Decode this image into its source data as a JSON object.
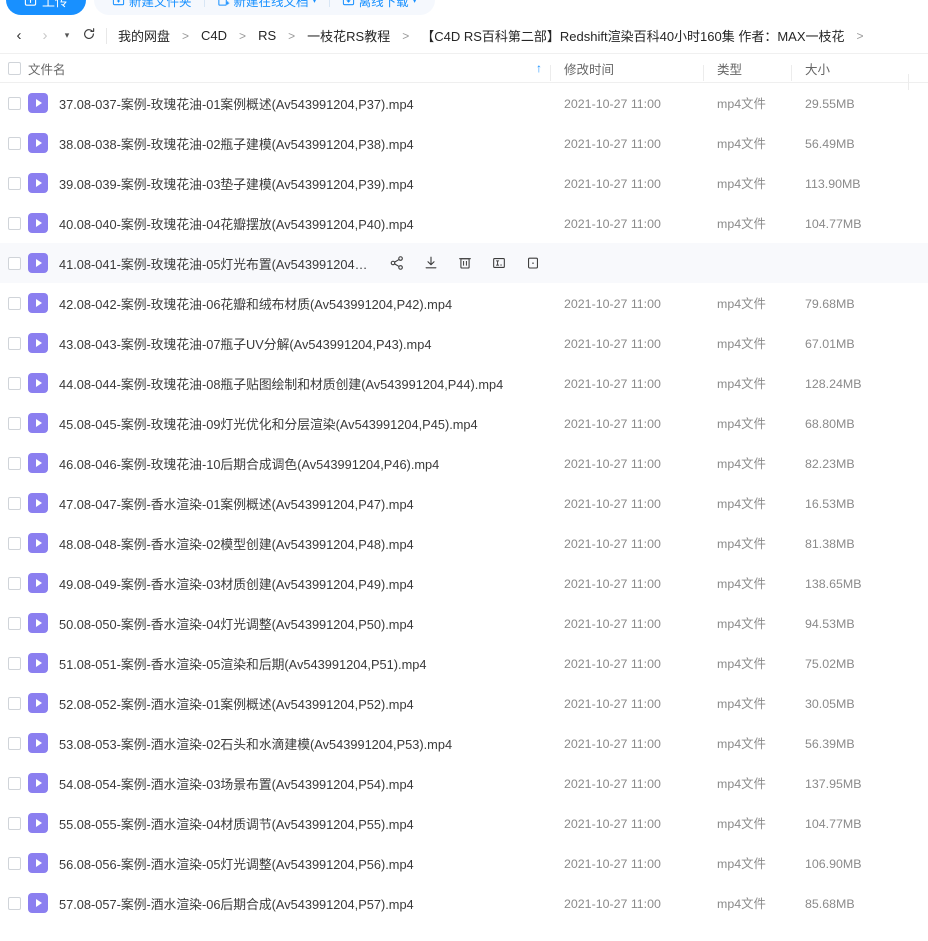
{
  "toolbar": {
    "upload_label": "上传",
    "new_folder_label": "新建文件夹",
    "new_doc_label": "新建在线文档",
    "offline_label": "离线下载"
  },
  "nav": {
    "back_icon": "chevron-left-icon",
    "forward_icon": "chevron-right-icon",
    "history_icon": "caret-down-icon",
    "refresh_icon": "refresh-icon"
  },
  "breadcrumb": {
    "separator": ">",
    "items": [
      "我的网盘",
      "C4D",
      "RS",
      "一枝花RS教程",
      "【C4D RS百科第二部】Redshift渲染百科40小时160集 作者：MAX一枝花"
    ],
    "trailing_separator": ">"
  },
  "table": {
    "columns": {
      "name": "文件名",
      "time": "修改时间",
      "type": "类型",
      "size": "大小"
    },
    "sort_indicator": "↑",
    "select_all_checkbox": "unchecked"
  },
  "hover_actions": [
    {
      "name": "share-icon",
      "label": "分享"
    },
    {
      "name": "download-icon",
      "label": "下载"
    },
    {
      "name": "delete-icon",
      "label": "删除"
    },
    {
      "name": "rename-icon",
      "label": "重命名"
    },
    {
      "name": "more-icon",
      "label": "更多"
    }
  ],
  "rows": [
    {
      "name": "37.08-037-案例-玫瑰花油-01案例概述(Av543991204,P37).mp4",
      "time": "2021-10-27 11:00",
      "type": "mp4文件",
      "size": "29.55MB",
      "hovered": false
    },
    {
      "name": "38.08-038-案例-玫瑰花油-02瓶子建模(Av543991204,P38).mp4",
      "time": "2021-10-27 11:00",
      "type": "mp4文件",
      "size": "56.49MB",
      "hovered": false
    },
    {
      "name": "39.08-039-案例-玫瑰花油-03垫子建模(Av543991204,P39).mp4",
      "time": "2021-10-27 11:00",
      "type": "mp4文件",
      "size": "113.90MB",
      "hovered": false
    },
    {
      "name": "40.08-040-案例-玫瑰花油-04花瓣摆放(Av543991204,P40).mp4",
      "time": "2021-10-27 11:00",
      "type": "mp4文件",
      "size": "104.77MB",
      "hovered": false
    },
    {
      "name": "41.08-041-案例-玫瑰花油-05灯光布置(Av543991204,P4...",
      "time": "",
      "type": "",
      "size": "",
      "hovered": true
    },
    {
      "name": "42.08-042-案例-玫瑰花油-06花瓣和绒布材质(Av543991204,P42).mp4",
      "time": "2021-10-27 11:00",
      "type": "mp4文件",
      "size": "79.68MB",
      "hovered": false
    },
    {
      "name": "43.08-043-案例-玫瑰花油-07瓶子UV分解(Av543991204,P43).mp4",
      "time": "2021-10-27 11:00",
      "type": "mp4文件",
      "size": "67.01MB",
      "hovered": false
    },
    {
      "name": "44.08-044-案例-玫瑰花油-08瓶子贴图绘制和材质创建(Av543991204,P44).mp4",
      "time": "2021-10-27 11:00",
      "type": "mp4文件",
      "size": "128.24MB",
      "hovered": false
    },
    {
      "name": "45.08-045-案例-玫瑰花油-09灯光优化和分层渲染(Av543991204,P45).mp4",
      "time": "2021-10-27 11:00",
      "type": "mp4文件",
      "size": "68.80MB",
      "hovered": false
    },
    {
      "name": "46.08-046-案例-玫瑰花油-10后期合成调色(Av543991204,P46).mp4",
      "time": "2021-10-27 11:00",
      "type": "mp4文件",
      "size": "82.23MB",
      "hovered": false
    },
    {
      "name": "47.08-047-案例-香水渲染-01案例概述(Av543991204,P47).mp4",
      "time": "2021-10-27 11:00",
      "type": "mp4文件",
      "size": "16.53MB",
      "hovered": false
    },
    {
      "name": "48.08-048-案例-香水渲染-02模型创建(Av543991204,P48).mp4",
      "time": "2021-10-27 11:00",
      "type": "mp4文件",
      "size": "81.38MB",
      "hovered": false
    },
    {
      "name": "49.08-049-案例-香水渲染-03材质创建(Av543991204,P49).mp4",
      "time": "2021-10-27 11:00",
      "type": "mp4文件",
      "size": "138.65MB",
      "hovered": false
    },
    {
      "name": "50.08-050-案例-香水渲染-04灯光调整(Av543991204,P50).mp4",
      "time": "2021-10-27 11:00",
      "type": "mp4文件",
      "size": "94.53MB",
      "hovered": false
    },
    {
      "name": "51.08-051-案例-香水渲染-05渲染和后期(Av543991204,P51).mp4",
      "time": "2021-10-27 11:00",
      "type": "mp4文件",
      "size": "75.02MB",
      "hovered": false
    },
    {
      "name": "52.08-052-案例-酒水渲染-01案例概述(Av543991204,P52).mp4",
      "time": "2021-10-27 11:00",
      "type": "mp4文件",
      "size": "30.05MB",
      "hovered": false
    },
    {
      "name": "53.08-053-案例-酒水渲染-02石头和水滴建模(Av543991204,P53).mp4",
      "time": "2021-10-27 11:00",
      "type": "mp4文件",
      "size": "56.39MB",
      "hovered": false
    },
    {
      "name": "54.08-054-案例-酒水渲染-03场景布置(Av543991204,P54).mp4",
      "time": "2021-10-27 11:00",
      "type": "mp4文件",
      "size": "137.95MB",
      "hovered": false
    },
    {
      "name": "55.08-055-案例-酒水渲染-04材质调节(Av543991204,P55).mp4",
      "time": "2021-10-27 11:00",
      "type": "mp4文件",
      "size": "104.77MB",
      "hovered": false
    },
    {
      "name": "56.08-056-案例-酒水渲染-05灯光调整(Av543991204,P56).mp4",
      "time": "2021-10-27 11:00",
      "type": "mp4文件",
      "size": "106.90MB",
      "hovered": false
    },
    {
      "name": "57.08-057-案例-酒水渲染-06后期合成(Av543991204,P57).mp4",
      "time": "2021-10-27 11:00",
      "type": "mp4文件",
      "size": "85.68MB",
      "hovered": false
    }
  ],
  "colors": {
    "accent": "#1890ff",
    "file_icon": "#8b7ff0",
    "hover_row": "#f8f9fc"
  }
}
